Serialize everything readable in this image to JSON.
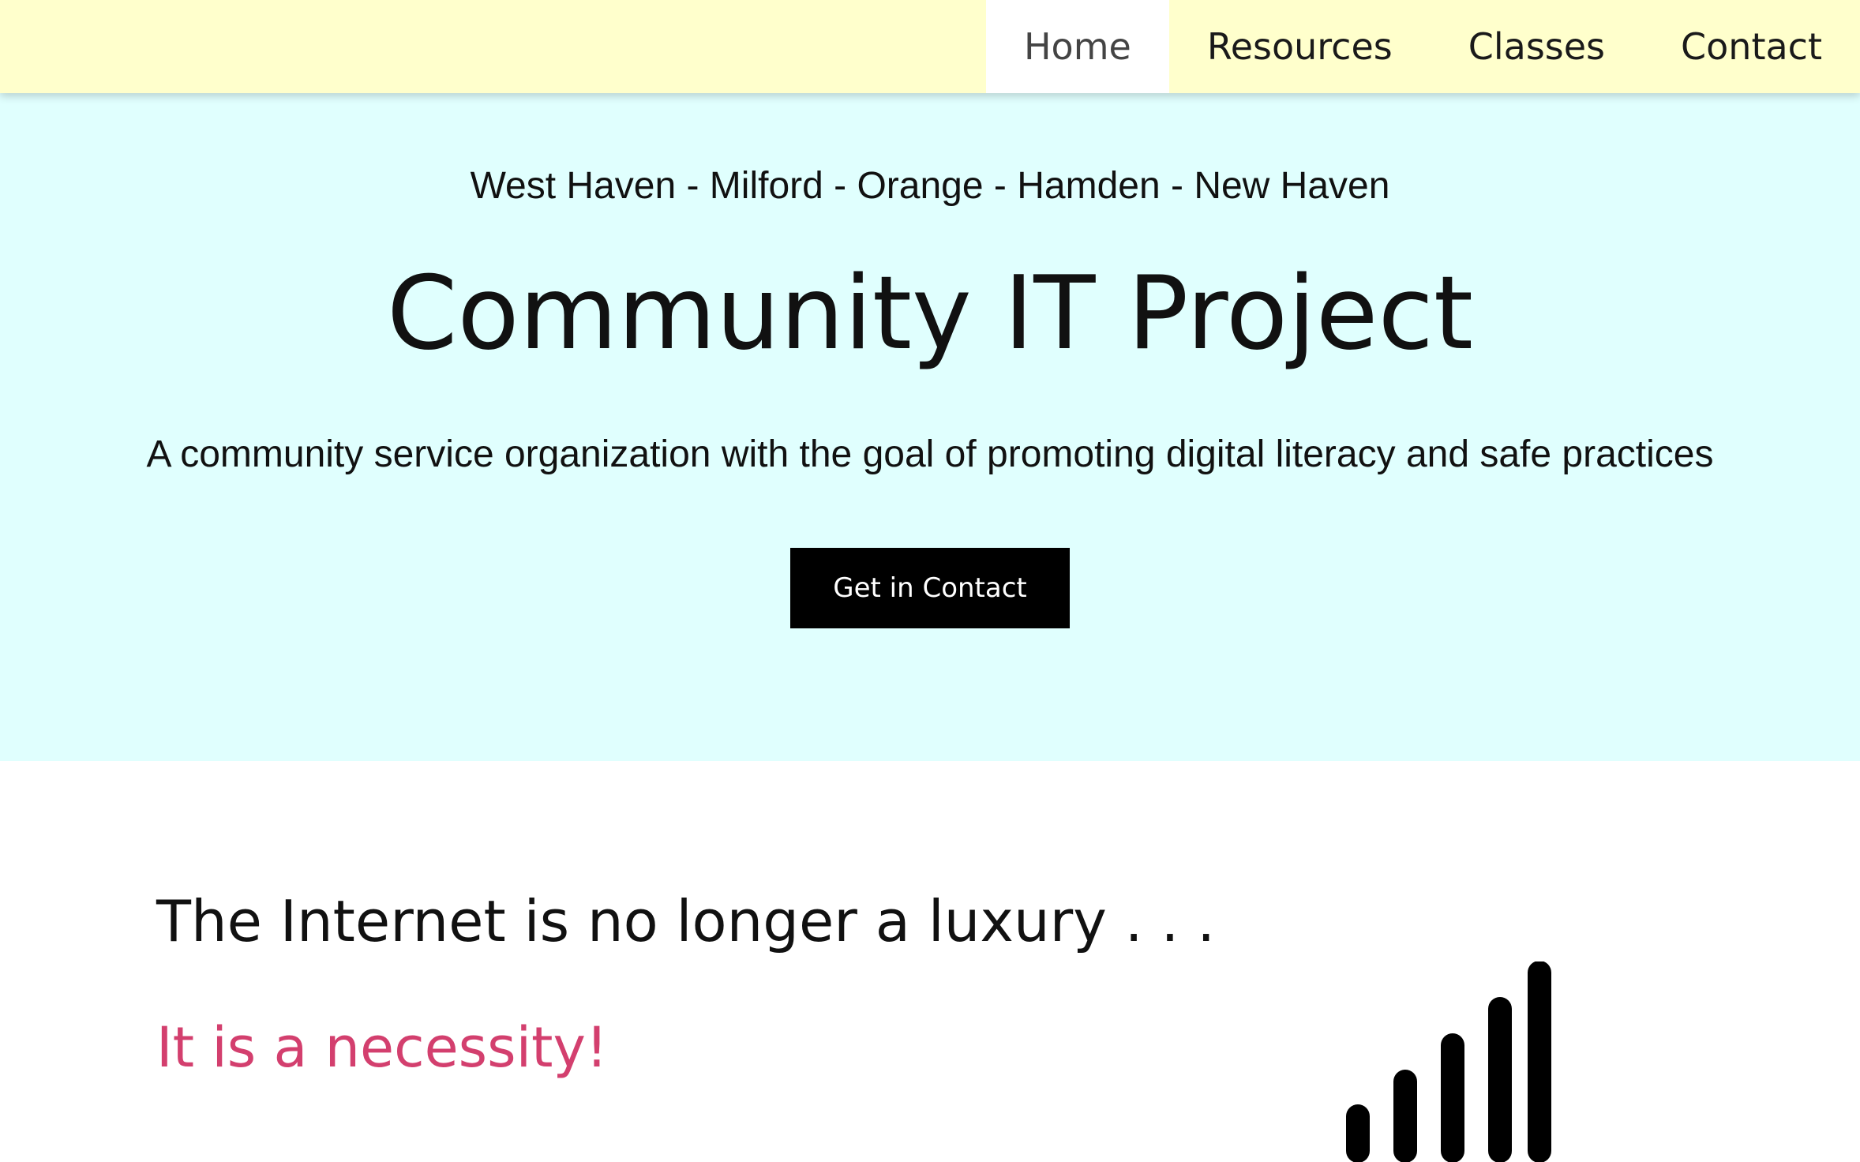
{
  "nav": {
    "items": [
      {
        "label": "Home",
        "active": true
      },
      {
        "label": "Resources",
        "active": false
      },
      {
        "label": "Classes",
        "active": false
      },
      {
        "label": "Contact",
        "active": false
      }
    ]
  },
  "hero": {
    "towns": "West Haven - Milford - Orange - Hamden - New Haven",
    "title": "Community IT Project",
    "tagline": "A community service organization with the goal of promoting digital literacy and safe practices",
    "cta_label": "Get in Contact"
  },
  "section": {
    "heading": "The Internet is no longer a luxury . . .",
    "subheading": "It is a necessity!",
    "icon": "signal-bars-icon"
  },
  "colors": {
    "navbar_bg": "#ffffcc",
    "hero_bg": "#e0fffe",
    "accent": "#d33f6e",
    "cta_bg": "#000000"
  }
}
